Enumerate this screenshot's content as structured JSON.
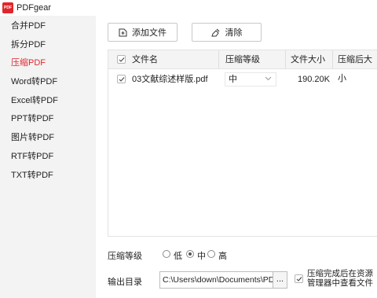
{
  "app": {
    "logo_text": "PDF",
    "title": "PDFgear"
  },
  "sidebar": {
    "items": [
      {
        "label": "合并PDF",
        "active": false
      },
      {
        "label": "拆分PDF",
        "active": false
      },
      {
        "label": "压缩PDF",
        "active": true
      },
      {
        "label": "Word转PDF",
        "active": false
      },
      {
        "label": "Excel转PDF",
        "active": false
      },
      {
        "label": "PPT转PDF",
        "active": false
      },
      {
        "label": "图片转PDF",
        "active": false
      },
      {
        "label": "RTF转PDF",
        "active": false
      },
      {
        "label": "TXT转PDF",
        "active": false
      }
    ]
  },
  "toolbar": {
    "add_label": "添加文件",
    "clear_label": "清除"
  },
  "table": {
    "columns": [
      "文件名",
      "压缩等级",
      "文件大小",
      "压缩后大小"
    ],
    "header_checked": true,
    "rows": [
      {
        "checked": true,
        "name": "03文献综述样版.pdf",
        "level": "中",
        "size": "190.20K",
        "compressed": ""
      }
    ]
  },
  "settings": {
    "level_label": "压缩等级",
    "level_options": [
      "低",
      "中",
      "高"
    ],
    "level_selected": "中",
    "output_label": "输出目录",
    "output_path": "C:\\Users\\down\\Documents\\PDFg",
    "browse_label": "...",
    "open_after_label": "压缩完成后在资源管理器中查看文件",
    "open_after_checked": true
  },
  "colors": {
    "accent": "#e0262b",
    "sidebar_bg": "#f3f3f3"
  }
}
